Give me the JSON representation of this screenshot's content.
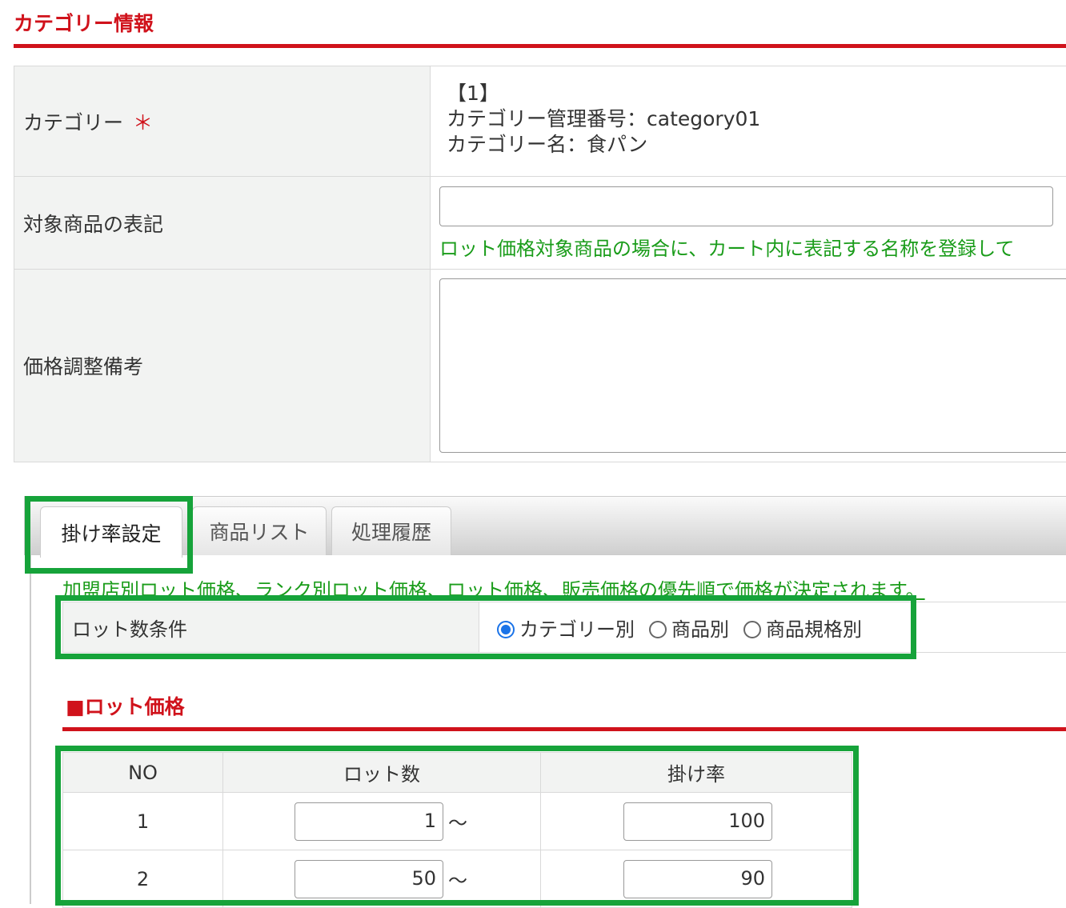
{
  "header": {
    "title": "カテゴリー情報"
  },
  "form": {
    "category_label": "カテゴリー",
    "required_mark": "＊",
    "category_index": "【1】",
    "category_code": "カテゴリー管理番号：category01",
    "category_name": "カテゴリー名：食パン",
    "target_label": "対象商品の表記",
    "target_value": "",
    "target_note": "ロット価格対象商品の場合に、カート内に表記する名称を登録して",
    "remarks_label": "価格調整備考",
    "remarks_value": ""
  },
  "tabs": [
    {
      "label": "掛け率設定",
      "active": true
    },
    {
      "label": "商品リスト"
    },
    {
      "label": "処理履歴"
    }
  ],
  "priority_note": "加盟店別ロット価格、ランク別ロット価格、ロット価格、販売価格の優先順で価格が決定されます。",
  "lot_condition": {
    "label": "ロット数条件",
    "options": [
      {
        "label": "カテゴリー別",
        "checked": true
      },
      {
        "label": "商品別",
        "checked": false
      },
      {
        "label": "商品規格別",
        "checked": false
      }
    ]
  },
  "lot_price": {
    "heading": "■ロット価格",
    "headers": [
      "NO",
      "ロット数",
      "掛け率"
    ],
    "tilde": "～",
    "rows": [
      {
        "no": "1",
        "lot": "1",
        "rate": "100"
      },
      {
        "no": "2",
        "lot": "50",
        "rate": "90"
      }
    ]
  },
  "colors": {
    "accent": "#d0121b",
    "note": "#1a9c1a",
    "highlight": "#16a33a"
  }
}
